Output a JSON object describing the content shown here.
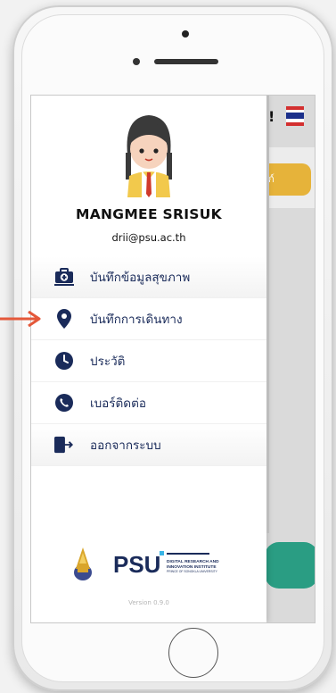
{
  "profile": {
    "name": "MANGMEE SRISUK",
    "email": "drii@psu.ac.th"
  },
  "menu": {
    "items": [
      {
        "label": "บันทึกข้อมูลสุขภาพ",
        "icon": "medical-kit-icon"
      },
      {
        "label": "บันทึกการเดินทาง",
        "icon": "map-pin-icon"
      },
      {
        "label": "ประวัติ",
        "icon": "clock-icon"
      },
      {
        "label": "เบอร์ติดต่อ",
        "icon": "phone-icon"
      },
      {
        "label": "ออกจากระบบ",
        "icon": "logout-icon"
      }
    ]
  },
  "background": {
    "button_fragment": "าก์"
  },
  "footer": {
    "logo_text": "PSU",
    "institute_lines": [
      "DIGITAL RESEARCH AND",
      "INNOVATION INSTITUTE",
      "PRINCE OF SONGKLA UNIVERSITY"
    ],
    "version": "Version 0.9.0"
  },
  "colors": {
    "accent_navy": "#1a2b5a",
    "highlight_arrow": "#e4583a",
    "yellow": "#e6b33a",
    "teal": "#2a9d83"
  }
}
